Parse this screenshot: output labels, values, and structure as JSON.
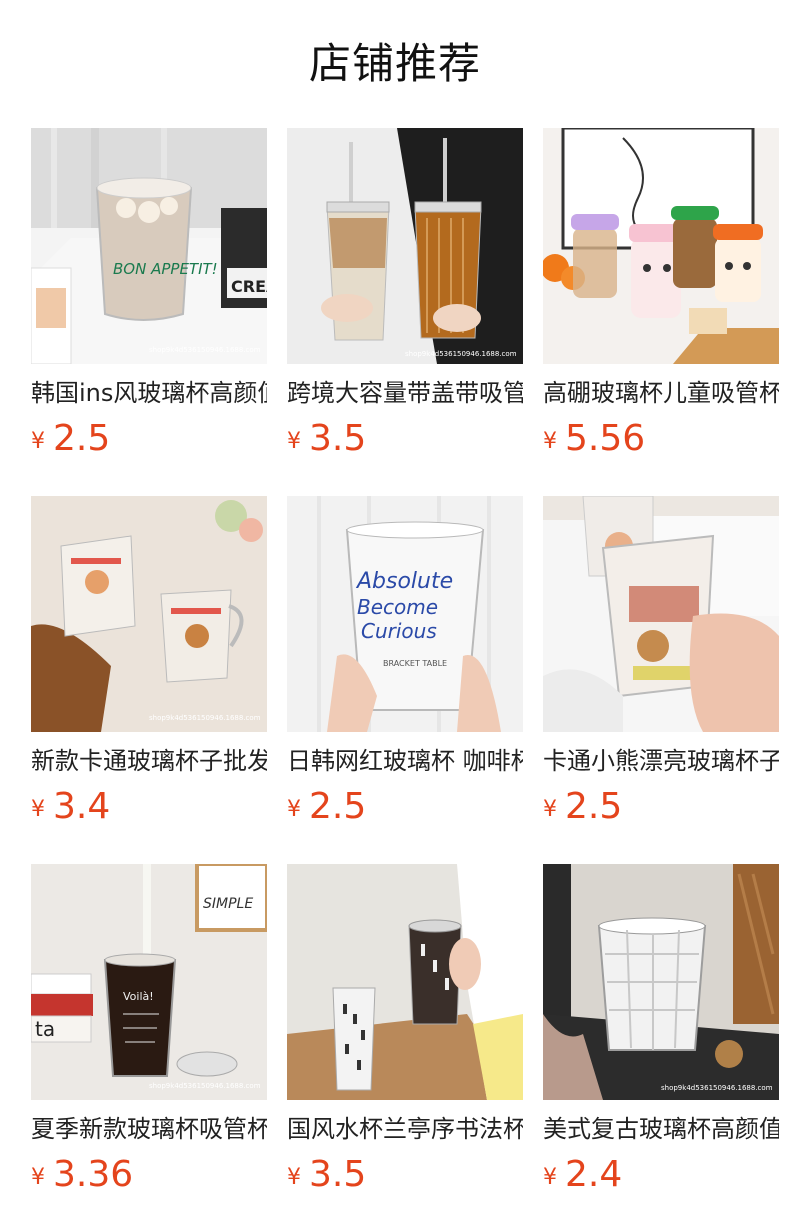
{
  "header": {
    "title": "店铺推荐"
  },
  "currency_symbol": "¥",
  "products": [
    {
      "name": "韩国ins风玻璃杯高颜值",
      "price": "2.5"
    },
    {
      "name": "跨境大容量带盖带吸管",
      "price": "3.5"
    },
    {
      "name": "高硼玻璃杯儿童吸管杯",
      "price": "5.56"
    },
    {
      "name": "新款卡通玻璃杯子批发",
      "price": "3.4"
    },
    {
      "name": "日韩网红玻璃杯 咖啡杯",
      "price": "2.5"
    },
    {
      "name": "卡通小熊漂亮玻璃杯子",
      "price": "2.5"
    },
    {
      "name": "夏季新款玻璃杯吸管杯",
      "price": "3.36"
    },
    {
      "name": "国风水杯兰亭序书法杯",
      "price": "3.5"
    },
    {
      "name": "美式复古玻璃杯高颜值",
      "price": "2.4"
    }
  ],
  "image_text": {
    "p1_cup": "BON APPETIT!",
    "p1_box": "CREA",
    "p5_cup_line1": "Absolute",
    "p5_cup_line2": "Become",
    "p5_cup_line3": "Curious",
    "p5_cup_small": "BRACKET TABLE",
    "p7_frame": "SIMPLE",
    "p7_book": "ta",
    "p7_cup": "Voilà!",
    "watermark": "shop9k4d536150946.1688.com"
  }
}
